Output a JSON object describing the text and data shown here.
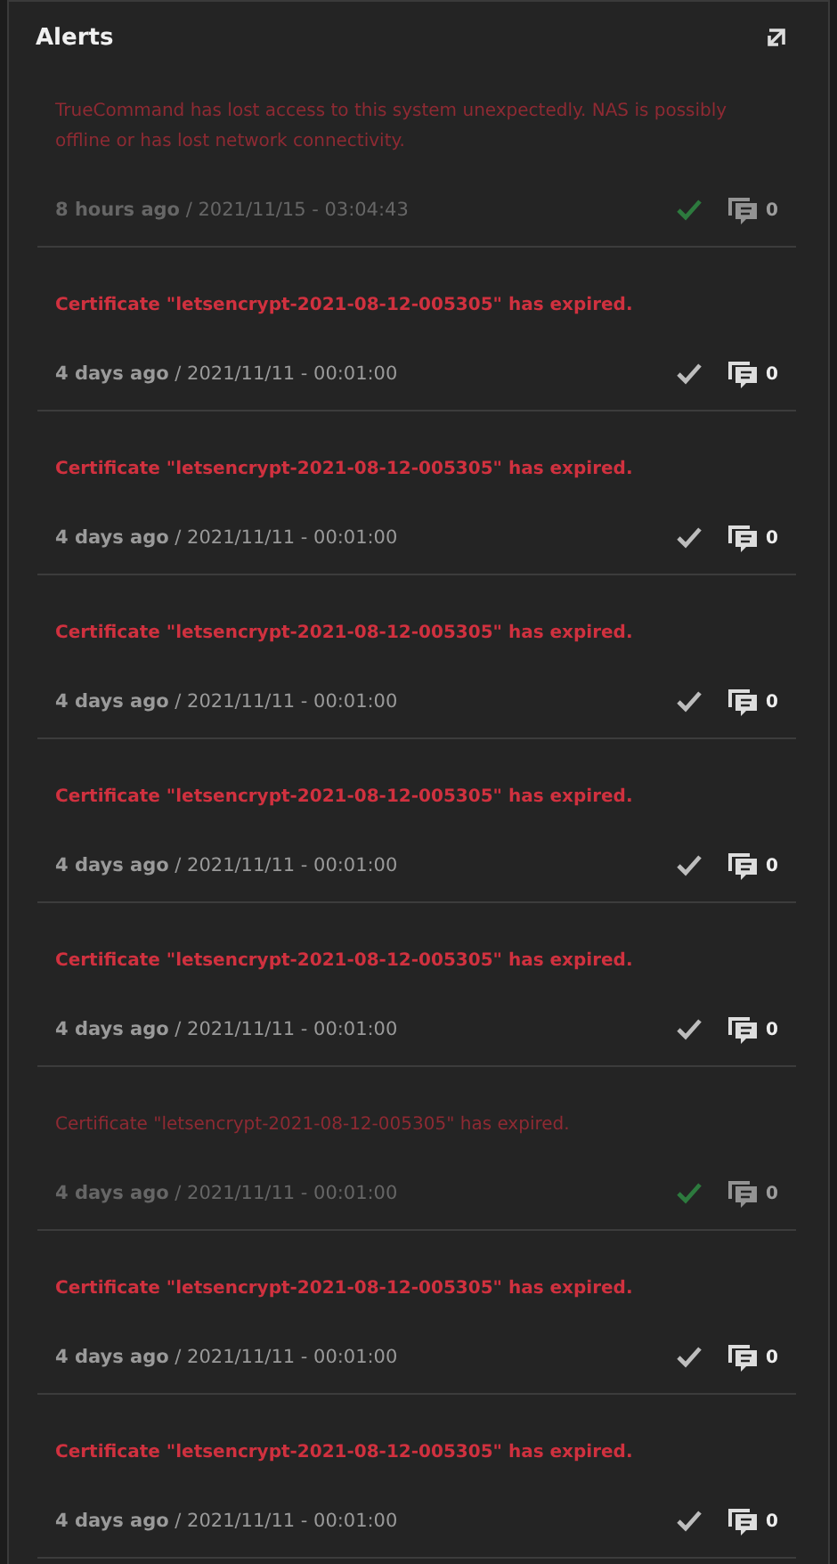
{
  "panel": {
    "title": "Alerts"
  },
  "alerts": [
    {
      "message": "TrueCommand has lost access to this system unexpectedly. NAS is possibly offline or has lost network connectivity.",
      "ago": "8 hours ago",
      "timestamp": "/ 2021/11/15 - 03:04:43",
      "dismissed": true,
      "comments": "0"
    },
    {
      "message": "Certificate \"letsencrypt-2021-08-12-005305\" has expired.",
      "ago": "4 days ago",
      "timestamp": "/ 2021/11/11 - 00:01:00",
      "dismissed": false,
      "comments": "0"
    },
    {
      "message": "Certificate \"letsencrypt-2021-08-12-005305\" has expired.",
      "ago": "4 days ago",
      "timestamp": "/ 2021/11/11 - 00:01:00",
      "dismissed": false,
      "comments": "0"
    },
    {
      "message": "Certificate \"letsencrypt-2021-08-12-005305\" has expired.",
      "ago": "4 days ago",
      "timestamp": "/ 2021/11/11 - 00:01:00",
      "dismissed": false,
      "comments": "0"
    },
    {
      "message": "Certificate \"letsencrypt-2021-08-12-005305\" has expired.",
      "ago": "4 days ago",
      "timestamp": "/ 2021/11/11 - 00:01:00",
      "dismissed": false,
      "comments": "0"
    },
    {
      "message": "Certificate \"letsencrypt-2021-08-12-005305\" has expired.",
      "ago": "4 days ago",
      "timestamp": "/ 2021/11/11 - 00:01:00",
      "dismissed": false,
      "comments": "0"
    },
    {
      "message": "Certificate \"letsencrypt-2021-08-12-005305\" has expired.",
      "ago": "4 days ago",
      "timestamp": "/ 2021/11/11 - 00:01:00",
      "dismissed": true,
      "comments": "0"
    },
    {
      "message": "Certificate \"letsencrypt-2021-08-12-005305\" has expired.",
      "ago": "4 days ago",
      "timestamp": "/ 2021/11/11 - 00:01:00",
      "dismissed": false,
      "comments": "0"
    },
    {
      "message": "Certificate \"letsencrypt-2021-08-12-005305\" has expired.",
      "ago": "4 days ago",
      "timestamp": "/ 2021/11/11 - 00:01:00",
      "dismissed": false,
      "comments": "0"
    }
  ]
}
